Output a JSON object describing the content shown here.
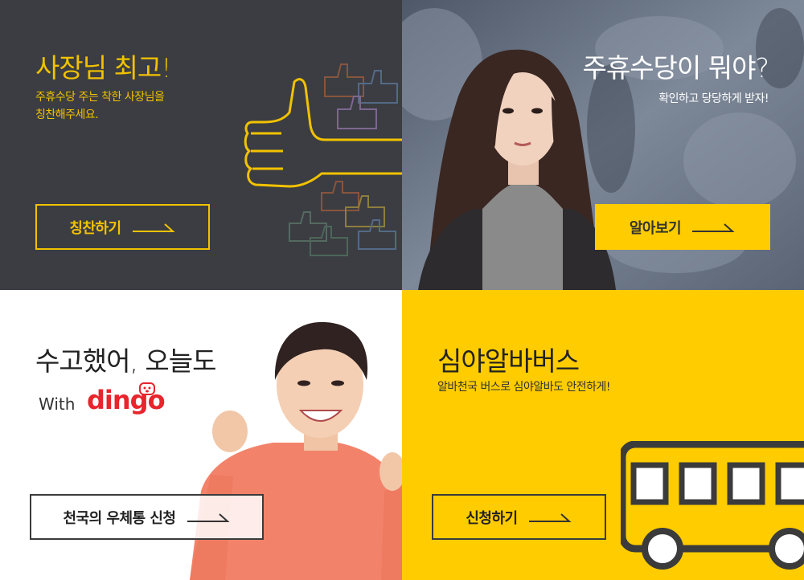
{
  "panels": {
    "boss": {
      "title": "사장님 최고!",
      "subtitle_line1": "주휴수당 주는 착한 사장님을",
      "subtitle_line2": "칭찬해주세요.",
      "button_label": "칭찬하기",
      "icon": "thumbs-up-icon"
    },
    "allowance": {
      "title": "주휴수당이 뭐야?",
      "subtitle": "확인하고 당당하게 받자!",
      "button_label": "알아보기"
    },
    "dingo": {
      "title": "수고했어, 오늘도",
      "with_label": "With",
      "brand": "dingo",
      "button_label": "천국의 우체통 신청"
    },
    "bus": {
      "title": "심야알바버스",
      "subtitle": "알바천국 버스로 심야알바도 안전하게!",
      "button_label": "신청하기",
      "icon": "bus-icon"
    }
  },
  "colors": {
    "dark": "#3b3d42",
    "yellow": "#ffcc00",
    "accent_yellow": "#f2c200",
    "dingo_red": "#e8242c"
  }
}
